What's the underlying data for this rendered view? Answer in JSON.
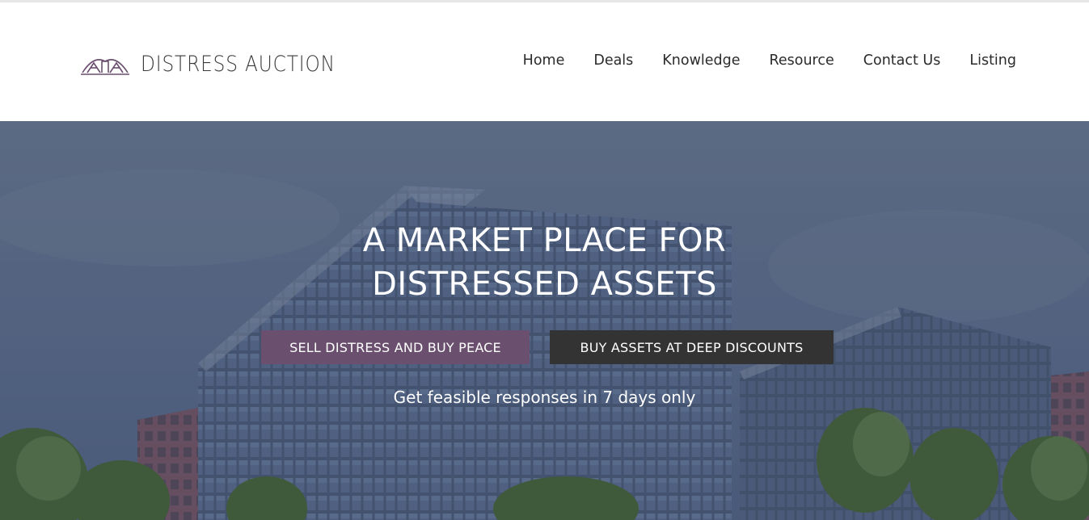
{
  "brand": {
    "name": "DISTRESS AUCTION",
    "logo_icon": "house-arch-logo-icon",
    "accent_color": "#6a4f6e"
  },
  "nav": {
    "items": [
      {
        "label": "Home"
      },
      {
        "label": "Deals"
      },
      {
        "label": "Knowledge"
      },
      {
        "label": "Resource"
      },
      {
        "label": "Contact Us"
      },
      {
        "label": "Listing"
      }
    ]
  },
  "hero": {
    "title_line1": "A MARKET PLACE FOR",
    "title_line2": "DISTRESSED ASSETS",
    "sell_button": "SELL DISTRESS AND BUY PEACE",
    "buy_button": "BUY ASSETS AT DEEP DISCOUNTS",
    "subtitle": "Get feasible responses in 7 days only",
    "sell_button_color": "#6a4f6e",
    "buy_button_color": "#333333",
    "background": "office-buildings-image"
  }
}
